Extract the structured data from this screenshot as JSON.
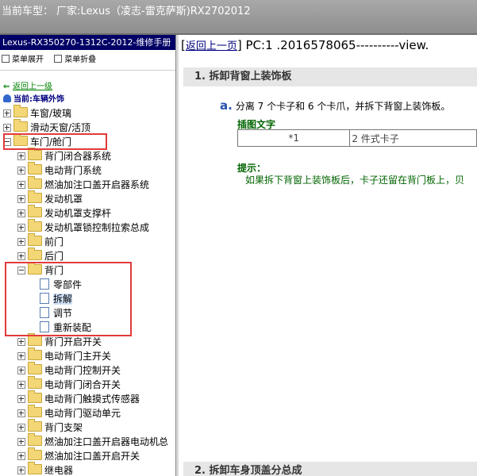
{
  "topbar": {
    "text": "当前车型： 厂家:Lexus（凌志-雷克萨斯)RX2702012"
  },
  "left": {
    "title": "Lexus-RX350270-1312C-2012-维修手册",
    "expand_label": "菜单展开",
    "collapse_label": "菜单折叠",
    "back_label": "返回上一级",
    "current_label": "当前:车辆外饰",
    "tree": [
      {
        "label": "车窗/玻璃",
        "level": 0,
        "type": "folder",
        "pm": "plus"
      },
      {
        "label": "滑动天窗/活顶",
        "level": 0,
        "type": "folder",
        "pm": "plus"
      },
      {
        "label": "车门/舱门",
        "level": 0,
        "type": "folder",
        "pm": "minus"
      },
      {
        "label": "背门闭合器系统",
        "level": 1,
        "type": "folder",
        "pm": "plus"
      },
      {
        "label": "电动背门系统",
        "level": 1,
        "type": "folder",
        "pm": "plus"
      },
      {
        "label": "燃油加注口盖开启器系统",
        "level": 1,
        "type": "folder",
        "pm": "plus"
      },
      {
        "label": "发动机罩",
        "level": 1,
        "type": "folder",
        "pm": "plus"
      },
      {
        "label": "发动机罩支撑杆",
        "level": 1,
        "type": "folder",
        "pm": "plus"
      },
      {
        "label": "发动机罩锁控制拉索总成",
        "level": 1,
        "type": "folder",
        "pm": "plus"
      },
      {
        "label": "前门",
        "level": 1,
        "type": "folder",
        "pm": "plus"
      },
      {
        "label": "后门",
        "level": 1,
        "type": "folder",
        "pm": "plus"
      },
      {
        "label": "背门",
        "level": 1,
        "type": "folder",
        "pm": "minus"
      },
      {
        "label": "零部件",
        "level": 2,
        "type": "doc"
      },
      {
        "label": "拆解",
        "level": 2,
        "type": "doc",
        "selected": true
      },
      {
        "label": "调节",
        "level": 2,
        "type": "doc"
      },
      {
        "label": "重新装配",
        "level": 2,
        "type": "doc"
      },
      {
        "label": "背门开启开关",
        "level": 1,
        "type": "folder",
        "pm": "plus"
      },
      {
        "label": "电动背门主开关",
        "level": 1,
        "type": "folder",
        "pm": "plus"
      },
      {
        "label": "电动背门控制开关",
        "level": 1,
        "type": "folder",
        "pm": "plus"
      },
      {
        "label": "电动背门闭合开关",
        "level": 1,
        "type": "folder",
        "pm": "plus"
      },
      {
        "label": "电动背门触摸式传感器",
        "level": 1,
        "type": "folder",
        "pm": "plus"
      },
      {
        "label": "电动背门驱动单元",
        "level": 1,
        "type": "folder",
        "pm": "plus"
      },
      {
        "label": "背门支架",
        "level": 1,
        "type": "folder",
        "pm": "plus"
      },
      {
        "label": "燃油加注口盖开启器电动机总",
        "level": 1,
        "type": "folder",
        "pm": "plus"
      },
      {
        "label": "燃油加注口盖开启开关",
        "level": 1,
        "type": "folder",
        "pm": "plus"
      },
      {
        "label": "继电器",
        "level": 1,
        "type": "folder",
        "pm": "plus"
      }
    ]
  },
  "right": {
    "back_link": "返回上一页",
    "pc_text": " PC:1 .2016578065----------view.",
    "section1": "1. 拆卸背窗上装饰板",
    "step_marker": "a.",
    "step_text": "分离 7 个卡子和 6 个卡爪，并拆下背窗上装饰板。",
    "caption": "插图文字",
    "table": [
      [
        "*1",
        "2 件式卡子"
      ]
    ],
    "tip_title": "提示：",
    "tip_text": "如果拆下背窗上装饰板后，卡子还留在背门板上，贝",
    "section2": "2. 拆卸车身顶盖分总成"
  }
}
